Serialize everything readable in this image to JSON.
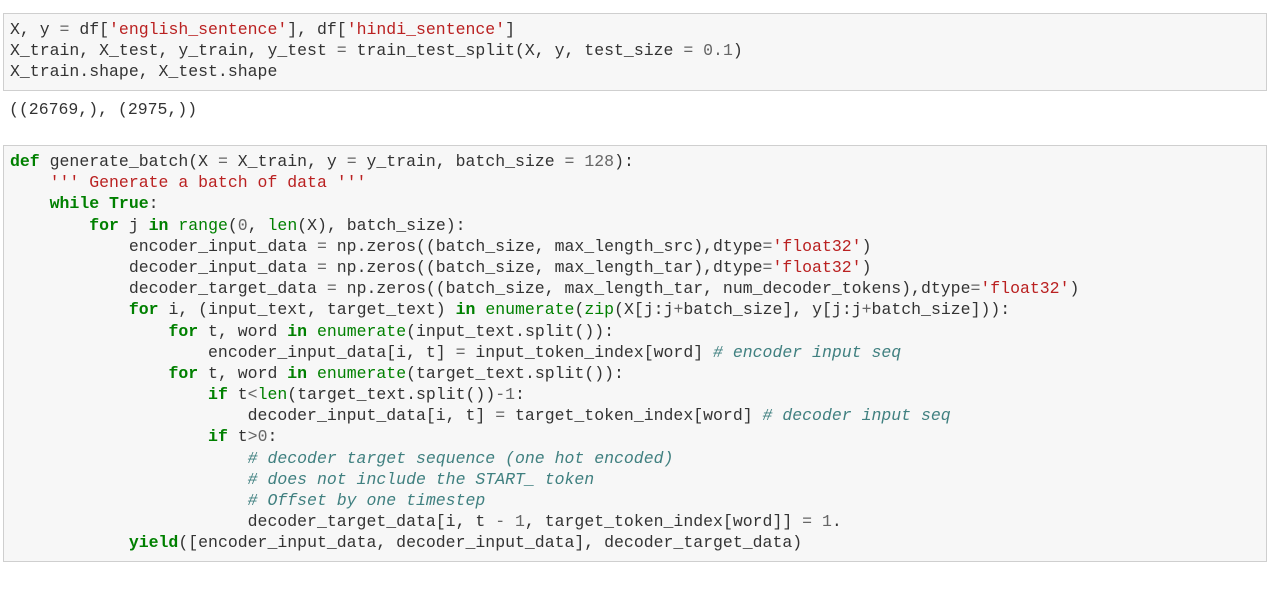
{
  "cell1": {
    "lines": [
      "X, y = df['english_sentence'], df['hindi_sentence']",
      "X_train, X_test, y_train, y_test = train_test_split(X, y, test_size = 0.1)",
      "X_train.shape, X_test.shape"
    ],
    "output": "((26769,), (2975,))"
  },
  "cell2": {
    "lines": [
      "def generate_batch(X = X_train, y = y_train, batch_size = 128):",
      "    ''' Generate a batch of data '''",
      "    while True:",
      "        for j in range(0, len(X), batch_size):",
      "            encoder_input_data = np.zeros((batch_size, max_length_src),dtype='float32')",
      "            decoder_input_data = np.zeros((batch_size, max_length_tar),dtype='float32')",
      "            decoder_target_data = np.zeros((batch_size, max_length_tar, num_decoder_tokens),dtype='float32')",
      "            for i, (input_text, target_text) in enumerate(zip(X[j:j+batch_size], y[j:j+batch_size])):",
      "                for t, word in enumerate(input_text.split()):",
      "                    encoder_input_data[i, t] = input_token_index[word] # encoder input seq",
      "                for t, word in enumerate(target_text.split()):",
      "                    if t<len(target_text.split())-1:",
      "                        decoder_input_data[i, t] = target_token_index[word] # decoder input seq",
      "                    if t>0:",
      "                        # decoder target sequence (one hot encoded)",
      "                        # does not include the START_ token",
      "                        # Offset by one timestep",
      "                        decoder_target_data[i, t - 1, target_token_index[word]] = 1.",
      "            yield([encoder_input_data, decoder_input_data], decoder_target_data)"
    ]
  }
}
